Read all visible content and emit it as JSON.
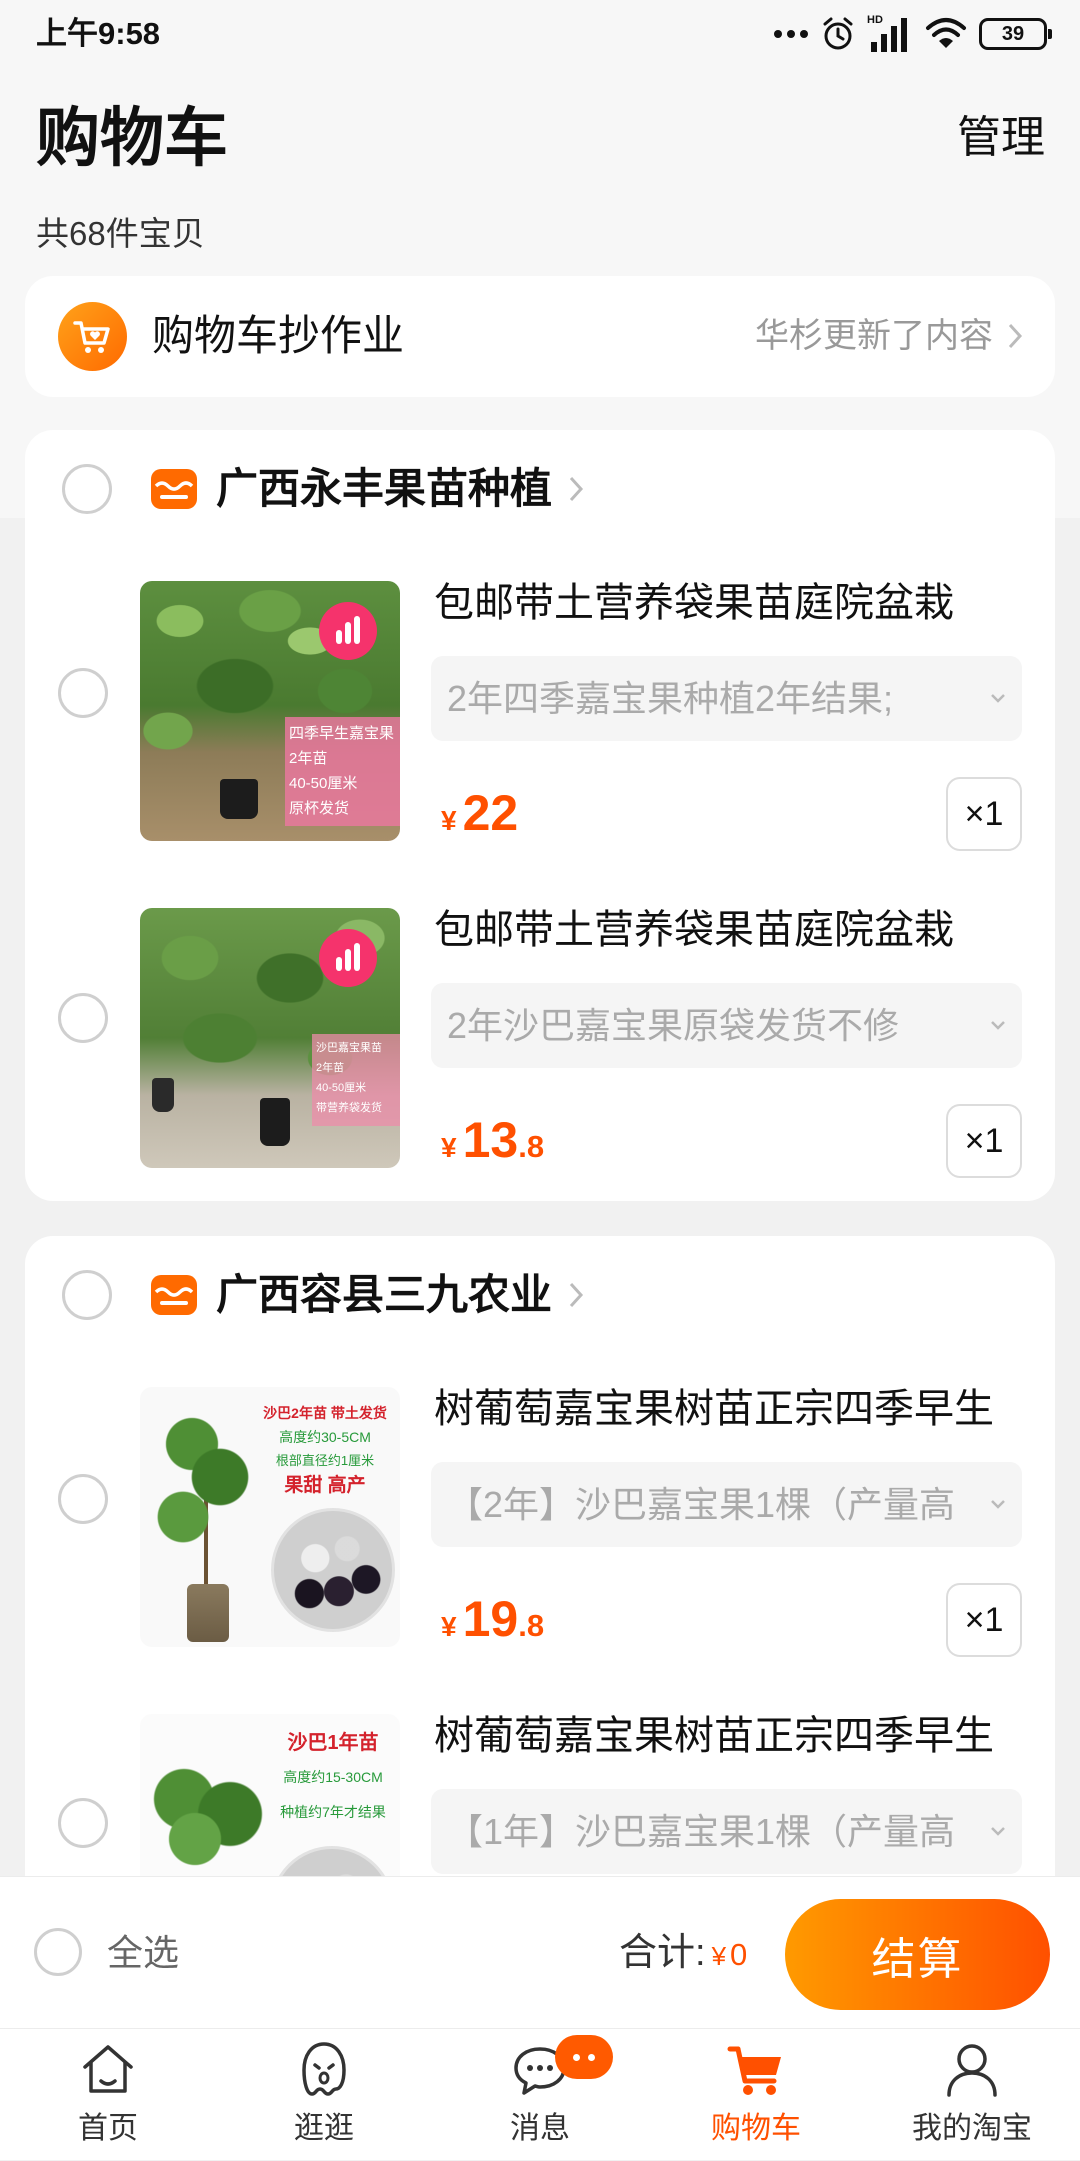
{
  "status_bar": {
    "time": "上午9:58",
    "network_label": "HD",
    "battery": "39"
  },
  "header": {
    "title": "购物车",
    "manage": "管理",
    "count": "共68件宝贝"
  },
  "promo": {
    "icon": "cart-heart-icon",
    "title": "购物车抄作业",
    "subtitle": "华杉更新了内容"
  },
  "currency": "¥",
  "stores": [
    {
      "name": "广西永丰果苗种植",
      "items": [
        {
          "title": "包邮带土营养袋果苗庭院盆栽",
          "sku": "2年四季嘉宝果种植2年结果;",
          "price_yuan": "22",
          "price_fraction": "",
          "quantity": "×1",
          "image_text": [
            "四季早生嘉宝果",
            "2年苗",
            "40-50厘米",
            "原杯发货"
          ]
        },
        {
          "title": "包邮带土营养袋果苗庭院盆栽",
          "sku": "2年沙巴嘉宝果原袋发货不修",
          "price_yuan": "13",
          "price_fraction": ".8",
          "quantity": "×1",
          "image_text": [
            "沙巴嘉宝果苗",
            "2年苗",
            "40-50厘米",
            "带营养袋发货"
          ]
        }
      ]
    },
    {
      "name": "广西容县三九农业",
      "items": [
        {
          "title": "树葡萄嘉宝果树苗正宗四季早生",
          "sku": "【2年】沙巴嘉宝果1棵（产量高",
          "price_yuan": "19",
          "price_fraction": ".8",
          "quantity": "×1",
          "image_text": [
            "沙巴2年苗 带土发货",
            "高度约30-5CM",
            "根部直径约1厘米",
            "果甜 高产"
          ]
        },
        {
          "title": "树葡萄嘉宝果树苗正宗四季早生",
          "sku": "【1年】沙巴嘉宝果1棵（产量高",
          "image_text": [
            "沙巴1年苗",
            "高度约15-30CM",
            "种植约7年才结果"
          ]
        }
      ]
    }
  ],
  "bottom_bar": {
    "select_all": "全选",
    "total_label": "合计:",
    "total": "0",
    "checkout": "结算"
  },
  "tabs": [
    {
      "label": "首页",
      "icon": "home-icon"
    },
    {
      "label": "逛逛",
      "icon": "guangguang-icon"
    },
    {
      "label": "消息",
      "icon": "message-icon",
      "badge": true
    },
    {
      "label": "购物车",
      "icon": "cart-icon",
      "active": true
    },
    {
      "label": "我的淘宝",
      "icon": "profile-icon"
    }
  ],
  "colors": {
    "accent": "#ff5000",
    "checkout_gradient_start": "#ff9a00",
    "checkout_gradient_end": "#ff5000",
    "store_icon": "#ff6a00",
    "image_badge": "#f5336c",
    "text_primary": "#111111",
    "text_secondary": "#999999",
    "sku_background": "#f5f5f5"
  }
}
